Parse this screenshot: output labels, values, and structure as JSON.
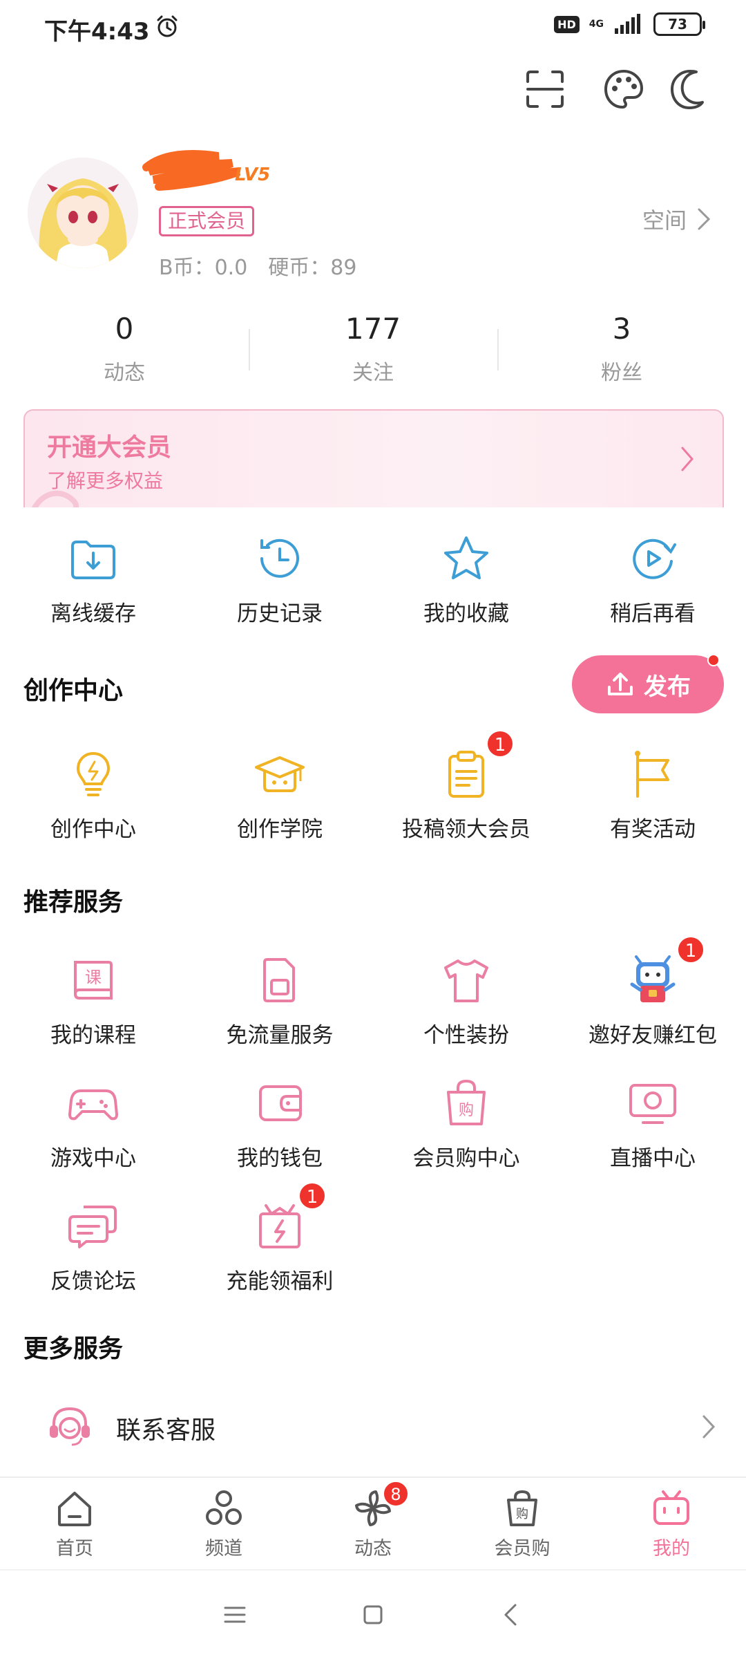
{
  "status_bar": {
    "time": "下午4:43",
    "hd": "HD",
    "network": "4G",
    "battery": "73"
  },
  "profile": {
    "level": "LV5",
    "member_badge": "正式会员",
    "b_coins": "B币：0.0",
    "hard_coins": "硬币：89",
    "space_label": "空间"
  },
  "stats": [
    {
      "value": "0",
      "label": "动态"
    },
    {
      "value": "177",
      "label": "关注"
    },
    {
      "value": "3",
      "label": "粉丝"
    }
  ],
  "vip_banner": {
    "title": "开通大会员",
    "subtitle": "了解更多权益"
  },
  "quick_actions": [
    {
      "label": "离线缓存",
      "icon": "offline-cache-icon"
    },
    {
      "label": "历史记录",
      "icon": "history-icon"
    },
    {
      "label": "我的收藏",
      "icon": "star-icon"
    },
    {
      "label": "稍后再看",
      "icon": "watch-later-icon"
    }
  ],
  "creation": {
    "title": "创作中心",
    "publish_label": "发布",
    "items": [
      {
        "label": "创作中心",
        "icon": "lightbulb-icon"
      },
      {
        "label": "创作学院",
        "icon": "graduation-cap-icon"
      },
      {
        "label": "投稿领大会员",
        "icon": "clipboard-icon",
        "badge": "1"
      },
      {
        "label": "有奖活动",
        "icon": "flag-icon"
      }
    ]
  },
  "recommended": {
    "title": "推荐服务",
    "items": [
      {
        "label": "我的课程",
        "icon": "course-book-icon",
        "glyph": "课"
      },
      {
        "label": "免流量服务",
        "icon": "sim-card-icon"
      },
      {
        "label": "个性装扮",
        "icon": "tshirt-icon"
      },
      {
        "label": "邀好友赚红包",
        "icon": "mascot-icon",
        "badge": "1"
      },
      {
        "label": "游戏中心",
        "icon": "gamepad-icon"
      },
      {
        "label": "我的钱包",
        "icon": "wallet-icon"
      },
      {
        "label": "会员购中心",
        "icon": "shopping-bag-icon",
        "glyph": "购"
      },
      {
        "label": "直播中心",
        "icon": "live-tv-icon"
      },
      {
        "label": "反馈论坛",
        "icon": "chat-bubbles-icon"
      },
      {
        "label": "充能领福利",
        "icon": "gift-box-icon",
        "badge": "1"
      }
    ]
  },
  "more_services": {
    "title": "更多服务",
    "items": [
      {
        "label": "联系客服",
        "icon": "headset-icon"
      }
    ]
  },
  "bottom_nav": [
    {
      "label": "首页",
      "icon": "home-icon"
    },
    {
      "label": "频道",
      "icon": "channel-icon"
    },
    {
      "label": "动态",
      "icon": "pinwheel-icon",
      "badge": "8"
    },
    {
      "label": "会员购",
      "icon": "shopping-bag-icon",
      "glyph": "购"
    },
    {
      "label": "我的",
      "icon": "tv-mascot-icon",
      "active": true
    }
  ],
  "colors": {
    "accent": "#f47197",
    "blue_icon": "#3d9ed6",
    "yellow_icon": "#f0b323",
    "pink_icon": "#ea7fa3",
    "badge_red": "#f0322c"
  }
}
